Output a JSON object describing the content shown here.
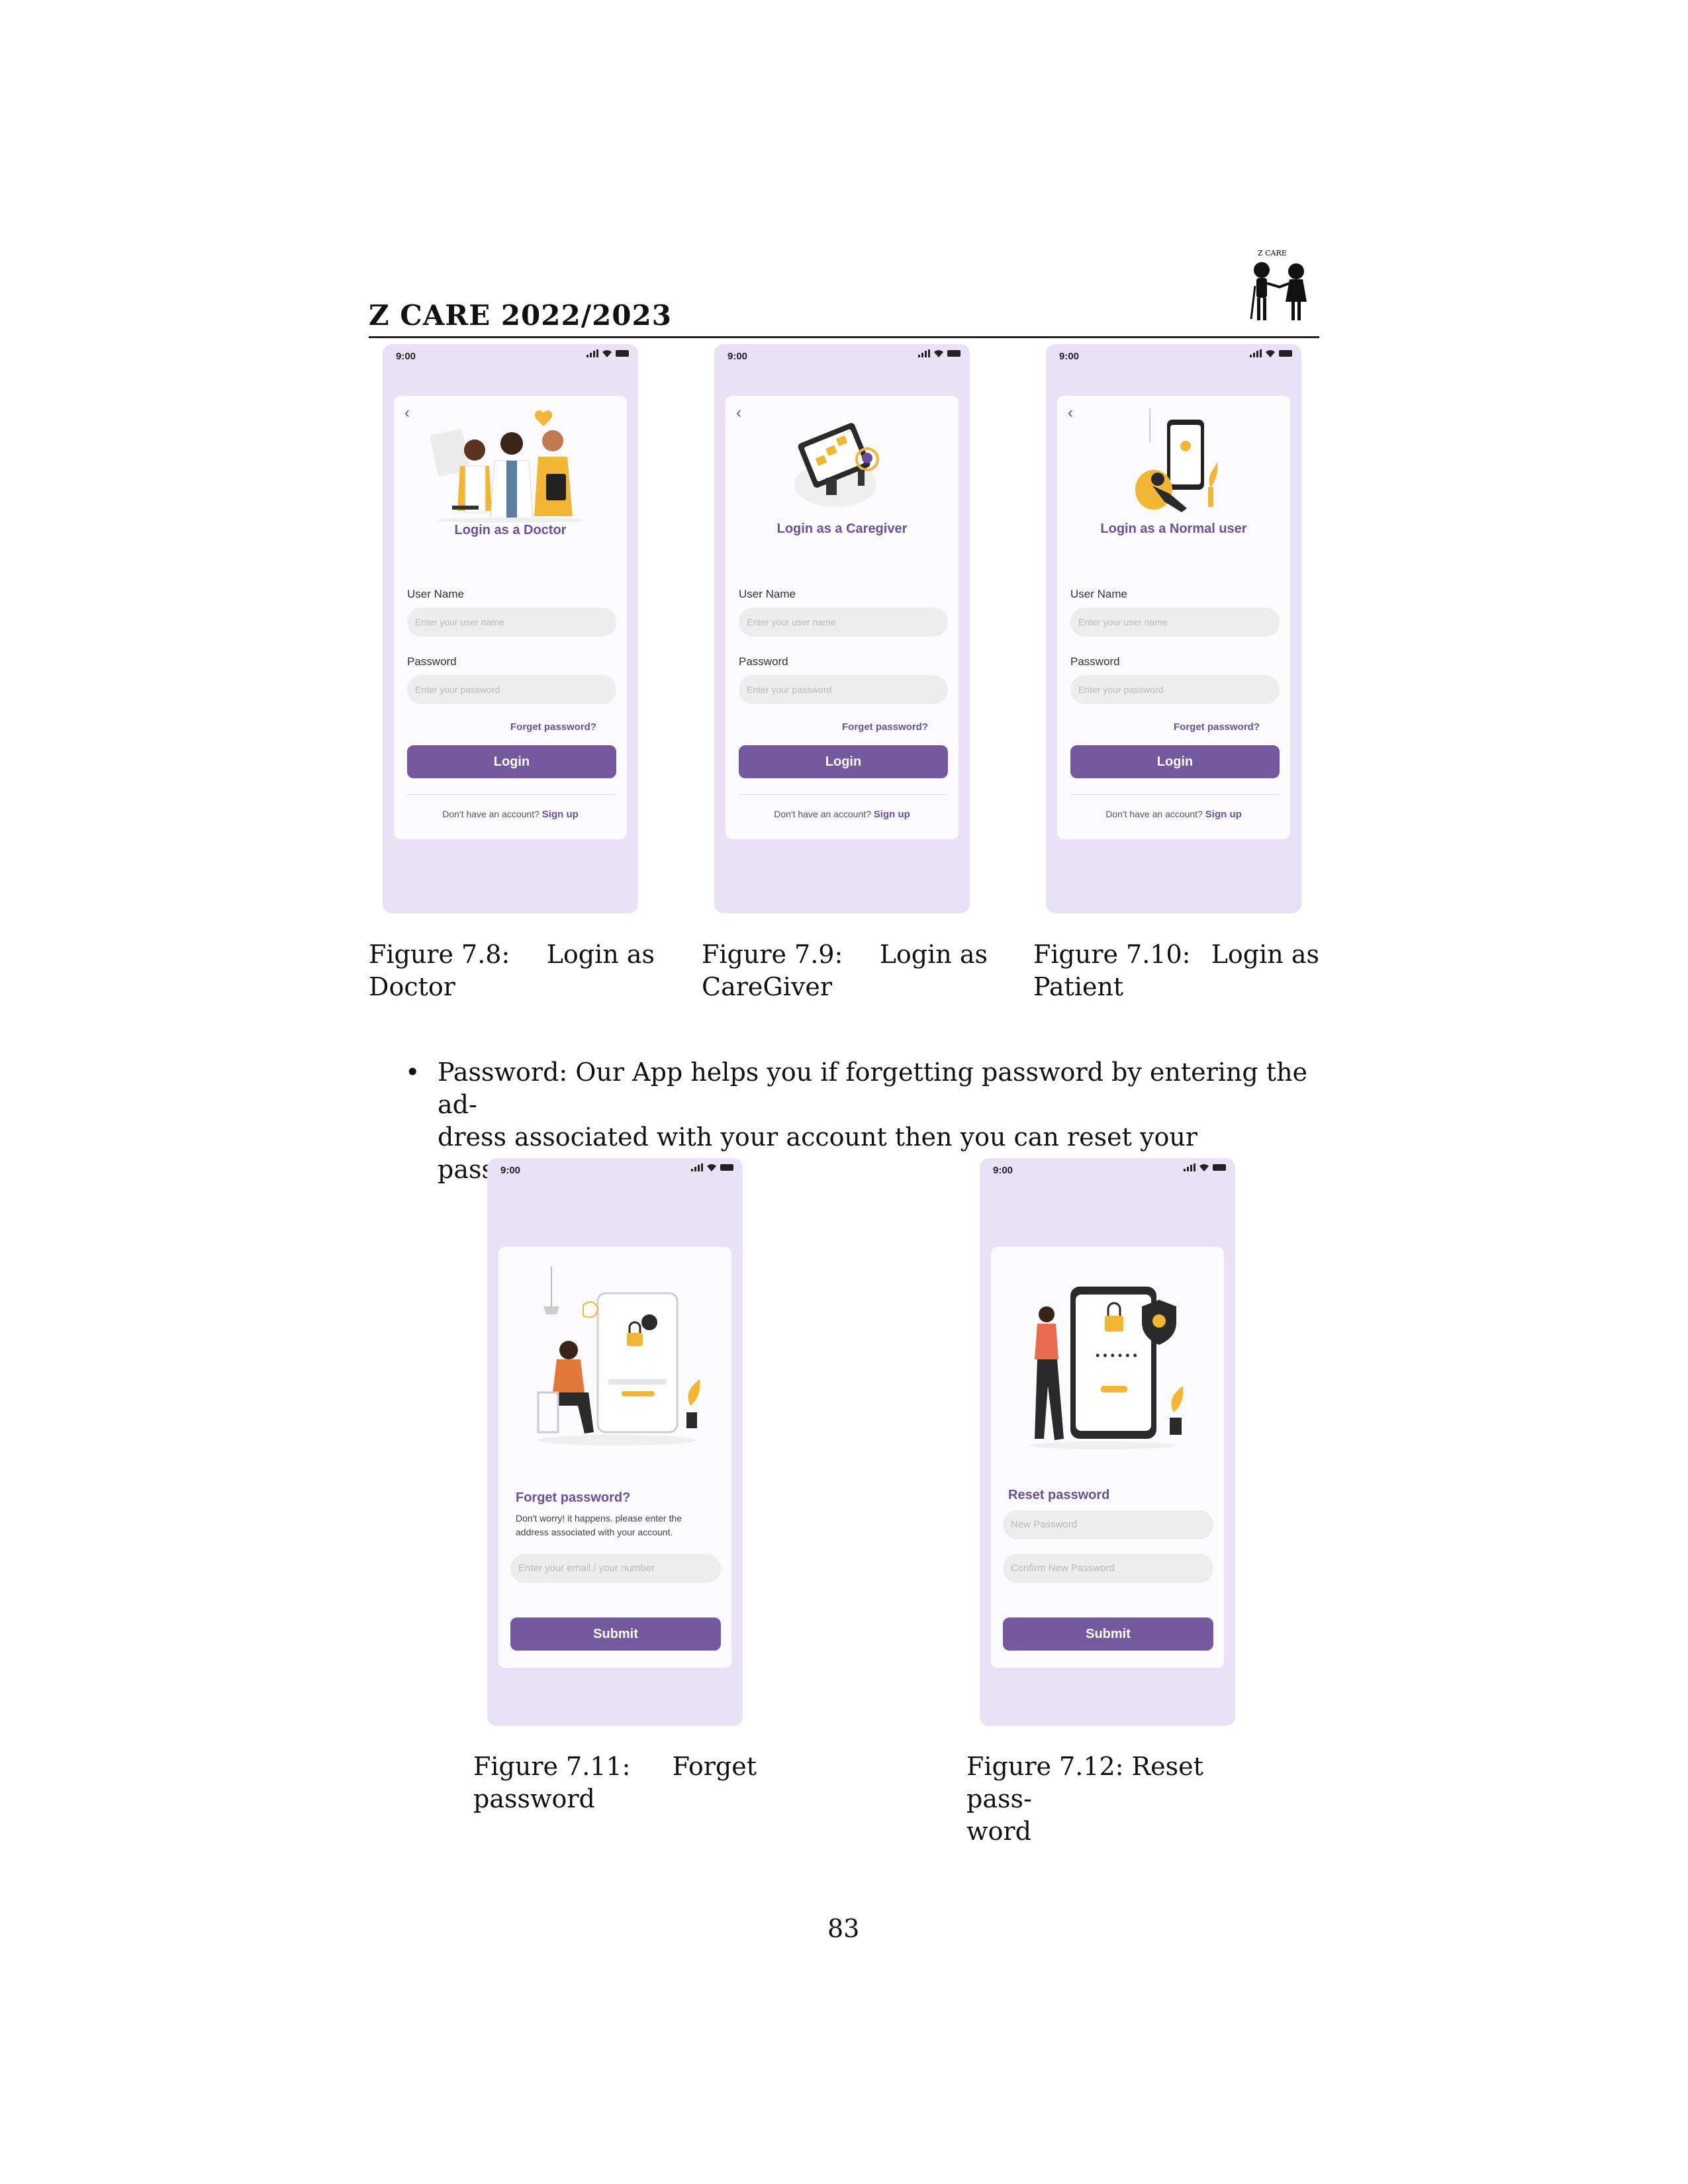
{
  "header": {
    "title": "Z CARE 2022/2023",
    "logo_text": "Z CARE"
  },
  "status_time": "9:00",
  "login": {
    "user_label": "User Name",
    "user_placeholder": "Enter your user name",
    "pass_label": "Password",
    "pass_placeholder": "Enter your password",
    "forget": "Forget password?",
    "button": "Login",
    "no_account": "Don't have an account?",
    "signup": "Sign up"
  },
  "screens": {
    "doctor": {
      "title": "Login as a Doctor"
    },
    "caregiver": {
      "title": "Login as a Caregiver"
    },
    "normal": {
      "title": "Login as a Normal user"
    }
  },
  "forget_screen": {
    "title": "Forget password?",
    "desc_line1": "Don't worry! it happens. please enter the",
    "desc_line2": "address associated with your account.",
    "placeholder": "Enter your email / your number",
    "button": "Submit"
  },
  "reset_screen": {
    "title": "Reset password",
    "new_placeholder": "New Password",
    "confirm_placeholder": "Confirm New Password",
    "button": "Submit"
  },
  "captions": {
    "fig78_a": "Figure 7.8:",
    "fig78_b": "Login as",
    "fig78_c": "Doctor",
    "fig79_a": "Figure 7.9:",
    "fig79_b": "Login as",
    "fig79_c": "CareGiver",
    "fig710_a": "Figure 7.10:",
    "fig710_b": "Login as",
    "fig710_c": "Patient",
    "fig711_a": "Figure 7.11:",
    "fig711_b": "Forget",
    "fig711_c": "password",
    "fig712_a": "Figure 7.12: Reset pass-",
    "fig712_c": "word"
  },
  "bullet": {
    "line1": "Password: Our App helps you if forgetting password by entering the ad-",
    "line2": "dress associated with your account then you can reset your password."
  },
  "page_number": "83",
  "colors": {
    "phone_bg": "#e9e1f5",
    "accent": "#74599f",
    "title_purple": "#6a4f9b",
    "illustration_yellow": "#f3b534"
  }
}
